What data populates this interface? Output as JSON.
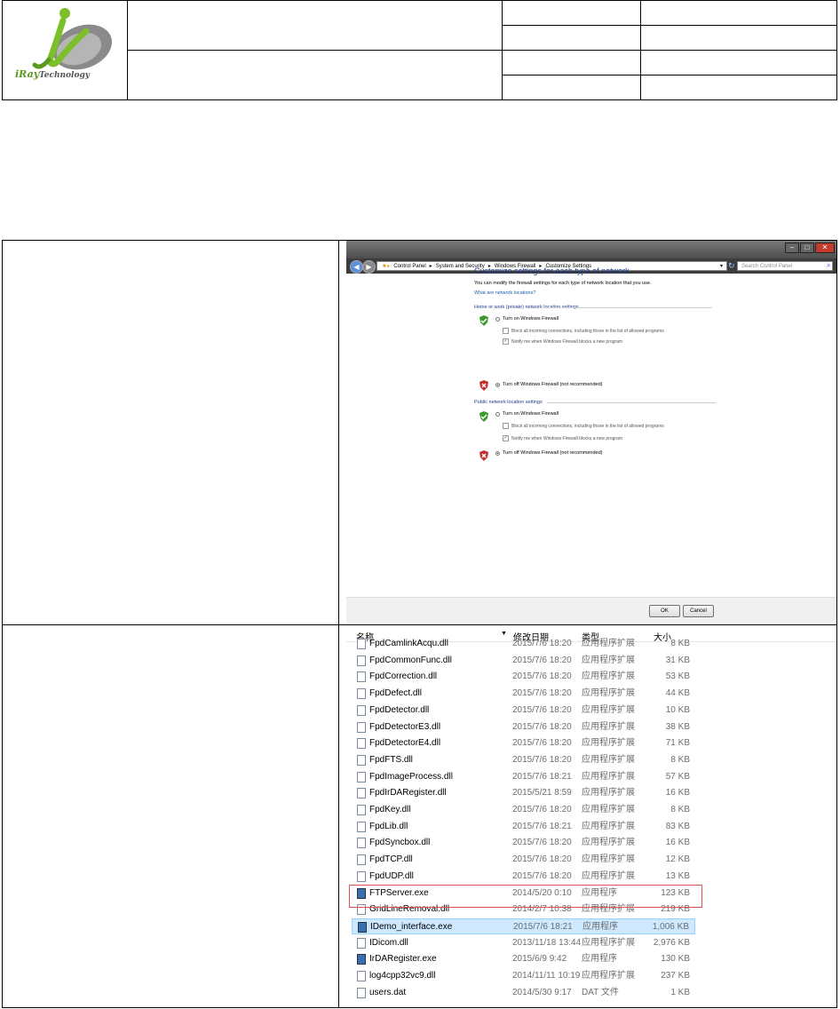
{
  "logo": {
    "brand": "iRayTechnology",
    "brand_prefix": "iRay",
    "brand_suffix": "Technology"
  },
  "firewall": {
    "breadcrumb": [
      "Control Panel",
      "System and Security",
      "Windows Firewall",
      "Customize Settings"
    ],
    "search_placeholder": "Search Control Panel",
    "heading": "Customize settings for each type of network",
    "description": "You can modify the firewall settings for each type of network location that you use.",
    "link": "What are network locations?",
    "sections": [
      {
        "title": "Home or work (private) network location settings",
        "turn_on": "Turn on Windows Firewall",
        "block": "Block all incoming connections, including those in the list of allowed programs",
        "notify": "Notify me when Windows Firewall blocks a new program",
        "turn_off": "Turn off Windows Firewall (not recommended)"
      },
      {
        "title": "Public network location settings",
        "turn_on": "Turn on Windows Firewall",
        "block": "Block all incoming connections, including those in the list of allowed programs",
        "notify": "Notify me when Windows Firewall blocks a new program",
        "turn_off": "Turn off Windows Firewall (not recommended)"
      }
    ],
    "ok": "OK",
    "cancel": "Cancel"
  },
  "explorer": {
    "columns": {
      "name": "名称",
      "date": "修改日期",
      "type": "类型",
      "size": "大小"
    },
    "files": [
      {
        "name": "FpdCamlinkAcqu.dll",
        "date": "2015/7/6 18:20",
        "type": "应用程序扩展",
        "size": "8 KB"
      },
      {
        "name": "FpdCommonFunc.dll",
        "date": "2015/7/6 18:20",
        "type": "应用程序扩展",
        "size": "31 KB"
      },
      {
        "name": "FpdCorrection.dll",
        "date": "2015/7/6 18:20",
        "type": "应用程序扩展",
        "size": "53 KB"
      },
      {
        "name": "FpdDefect.dll",
        "date": "2015/7/6 18:20",
        "type": "应用程序扩展",
        "size": "44 KB"
      },
      {
        "name": "FpdDetector.dll",
        "date": "2015/7/6 18:20",
        "type": "应用程序扩展",
        "size": "10 KB"
      },
      {
        "name": "FpdDetectorE3.dll",
        "date": "2015/7/6 18:20",
        "type": "应用程序扩展",
        "size": "38 KB"
      },
      {
        "name": "FpdDetectorE4.dll",
        "date": "2015/7/6 18:20",
        "type": "应用程序扩展",
        "size": "71 KB"
      },
      {
        "name": "FpdFTS.dll",
        "date": "2015/7/6 18:20",
        "type": "应用程序扩展",
        "size": "8 KB"
      },
      {
        "name": "FpdImageProcess.dll",
        "date": "2015/7/6 18:21",
        "type": "应用程序扩展",
        "size": "57 KB"
      },
      {
        "name": "FpdIrDARegister.dll",
        "date": "2015/5/21 8:59",
        "type": "应用程序扩展",
        "size": "16 KB"
      },
      {
        "name": "FpdKey.dll",
        "date": "2015/7/6 18:20",
        "type": "应用程序扩展",
        "size": "8 KB"
      },
      {
        "name": "FpdLib.dll",
        "date": "2015/7/6 18:21",
        "type": "应用程序扩展",
        "size": "83 KB"
      },
      {
        "name": "FpdSyncbox.dll",
        "date": "2015/7/6 18:20",
        "type": "应用程序扩展",
        "size": "16 KB"
      },
      {
        "name": "FpdTCP.dll",
        "date": "2015/7/6 18:20",
        "type": "应用程序扩展",
        "size": "12 KB"
      },
      {
        "name": "FpdUDP.dll",
        "date": "2015/7/6 18:20",
        "type": "应用程序扩展",
        "size": "13 KB"
      },
      {
        "name": "FTPServer.exe",
        "date": "2014/5/20 0:10",
        "type": "应用程序",
        "size": "123 KB"
      },
      {
        "name": "GridLineRemoval.dll",
        "date": "2014/2/7 10:38",
        "type": "应用程序扩展",
        "size": "219 KB"
      },
      {
        "name": "IDemo_interface.exe",
        "date": "2015/7/6 18:21",
        "type": "应用程序",
        "size": "1,006 KB"
      },
      {
        "name": "IDicom.dll",
        "date": "2013/11/18 13:44",
        "type": "应用程序扩展",
        "size": "2,976 KB"
      },
      {
        "name": "IrDARegister.exe",
        "date": "2015/6/9 9:42",
        "type": "应用程序",
        "size": "130 KB"
      },
      {
        "name": "log4cpp32vc9.dll",
        "date": "2014/11/11 10:19",
        "type": "应用程序扩展",
        "size": "237 KB"
      },
      {
        "name": "users.dat",
        "date": "2014/5/30 9:17",
        "type": "DAT 文件",
        "size": "1 KB"
      }
    ]
  }
}
